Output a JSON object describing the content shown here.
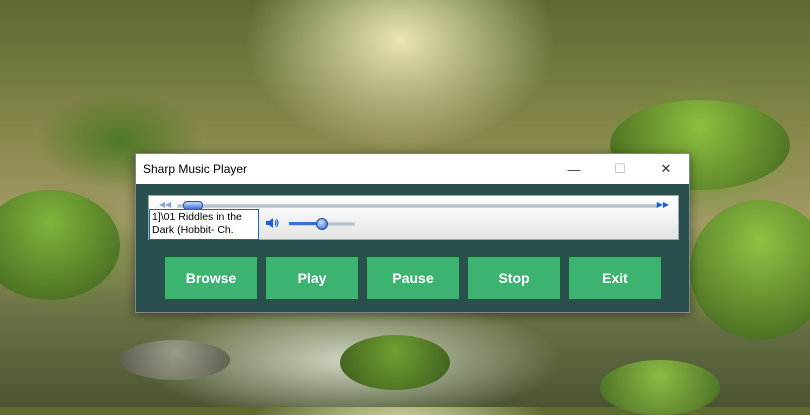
{
  "window": {
    "title": "Sharp Music Player",
    "minimize_glyph": "—",
    "maximize_glyph": "☐",
    "close_glyph": "✕"
  },
  "player": {
    "track_text": "1]\\01 Riddles in the Dark (Hobbit- Ch.",
    "seek_back_icon": "◀◀",
    "seek_forward_icon": "▶▶",
    "seek_position_percent": 4,
    "volume_percent": 50
  },
  "buttons": {
    "browse": "Browse",
    "play": "Play",
    "pause": "Pause",
    "stop": "Stop",
    "exit": "Exit"
  },
  "colors": {
    "button_green": "#3cb371",
    "window_body": "#2a4f4f",
    "accent_blue": "#3a6fd8"
  }
}
